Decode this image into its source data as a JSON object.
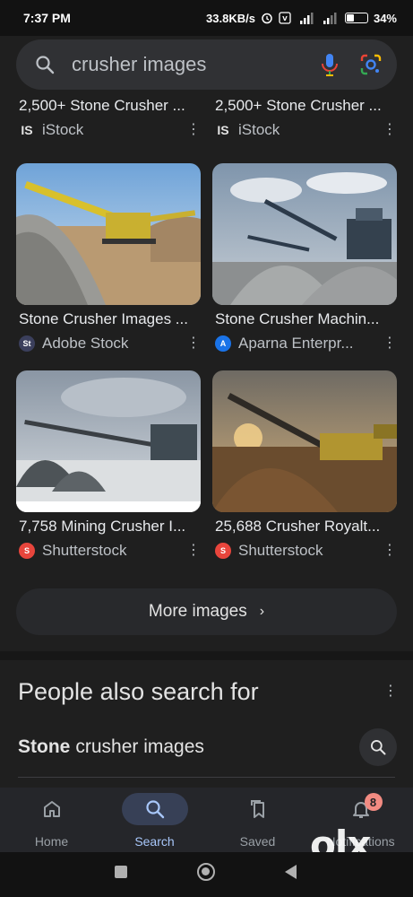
{
  "status_bar": {
    "time": "7:37 PM",
    "net_speed": "33.8KB/s",
    "battery": "34%",
    "battery_level": 0.34
  },
  "search": {
    "query": "crusher images"
  },
  "results": [
    {
      "title": "2,500+ Stone Crusher ...",
      "source": "iStock",
      "favicon": "IS",
      "favicon_color": "#1f1f1f"
    },
    {
      "title": "2,500+ Stone Crusher ...",
      "source": "iStock",
      "favicon": "IS",
      "favicon_color": "#1f1f1f"
    },
    {
      "title": "Stone Crusher Images ...",
      "source": "Adobe Stock",
      "favicon": "St",
      "favicon_color": "#3b3f5c"
    },
    {
      "title": "Stone Crusher Machin...",
      "source": "Aparna Enterpr...",
      "favicon": "A",
      "favicon_color": "#1a73e8"
    },
    {
      "title": "7,758 Mining Crusher I...",
      "source": "Shutterstock",
      "favicon": "S",
      "favicon_color": "#e8453c"
    },
    {
      "title": "25,688 Crusher Royalt...",
      "source": "Shutterstock",
      "favicon": "S",
      "favicon_color": "#e8453c"
    }
  ],
  "more_images": {
    "label": "More images"
  },
  "people_also_search": {
    "title": "People also search for",
    "items": [
      {
        "bold": "Stone",
        "rest": "crusher images"
      }
    ]
  },
  "bottom_nav": {
    "items": [
      {
        "label": "Home",
        "icon": "home-icon"
      },
      {
        "label": "Search",
        "icon": "search-icon",
        "active": true
      },
      {
        "label": "Saved",
        "icon": "bookmark-icon"
      },
      {
        "label": "Notifications",
        "icon": "bell-icon",
        "badge": "8"
      }
    ]
  },
  "watermark": "OLX",
  "colors": {
    "accent": "#a8c7fa",
    "background": "#1f1f1f",
    "badge": "#f28b82"
  }
}
